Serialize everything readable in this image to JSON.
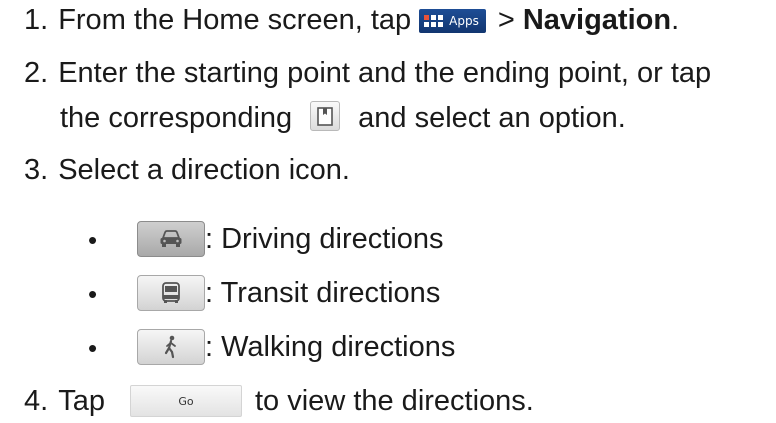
{
  "steps": [
    {
      "number": "1.",
      "text_before": "From the Home screen, tap",
      "apps_button_label": "Apps",
      "separator": ">",
      "bold_text": "Navigation",
      "period": "."
    },
    {
      "number": "2.",
      "line1": "Enter the starting point and the ending point, or tap",
      "line2_before": "the corresponding",
      "line2_after": "and select an option."
    },
    {
      "number": "3.",
      "text": "Select a direction icon."
    },
    {
      "number": "4.",
      "text_before": "Tap",
      "go_button_label": "Go",
      "text_after": "to view the directions."
    }
  ],
  "direction_options": [
    {
      "bullet": "•",
      "icon": "car-icon",
      "label": ": Driving directions"
    },
    {
      "bullet": "•",
      "icon": "bus-icon",
      "label": ": Transit directions"
    },
    {
      "bullet": "•",
      "icon": "pedestrian-icon",
      "label": ": Walking directions"
    }
  ],
  "icons": {
    "apps": "apps-grid-icon",
    "bookmark": "bookmark-icon"
  },
  "colors": {
    "apps_button": "#1a4584",
    "text": "#1a1a1a"
  }
}
